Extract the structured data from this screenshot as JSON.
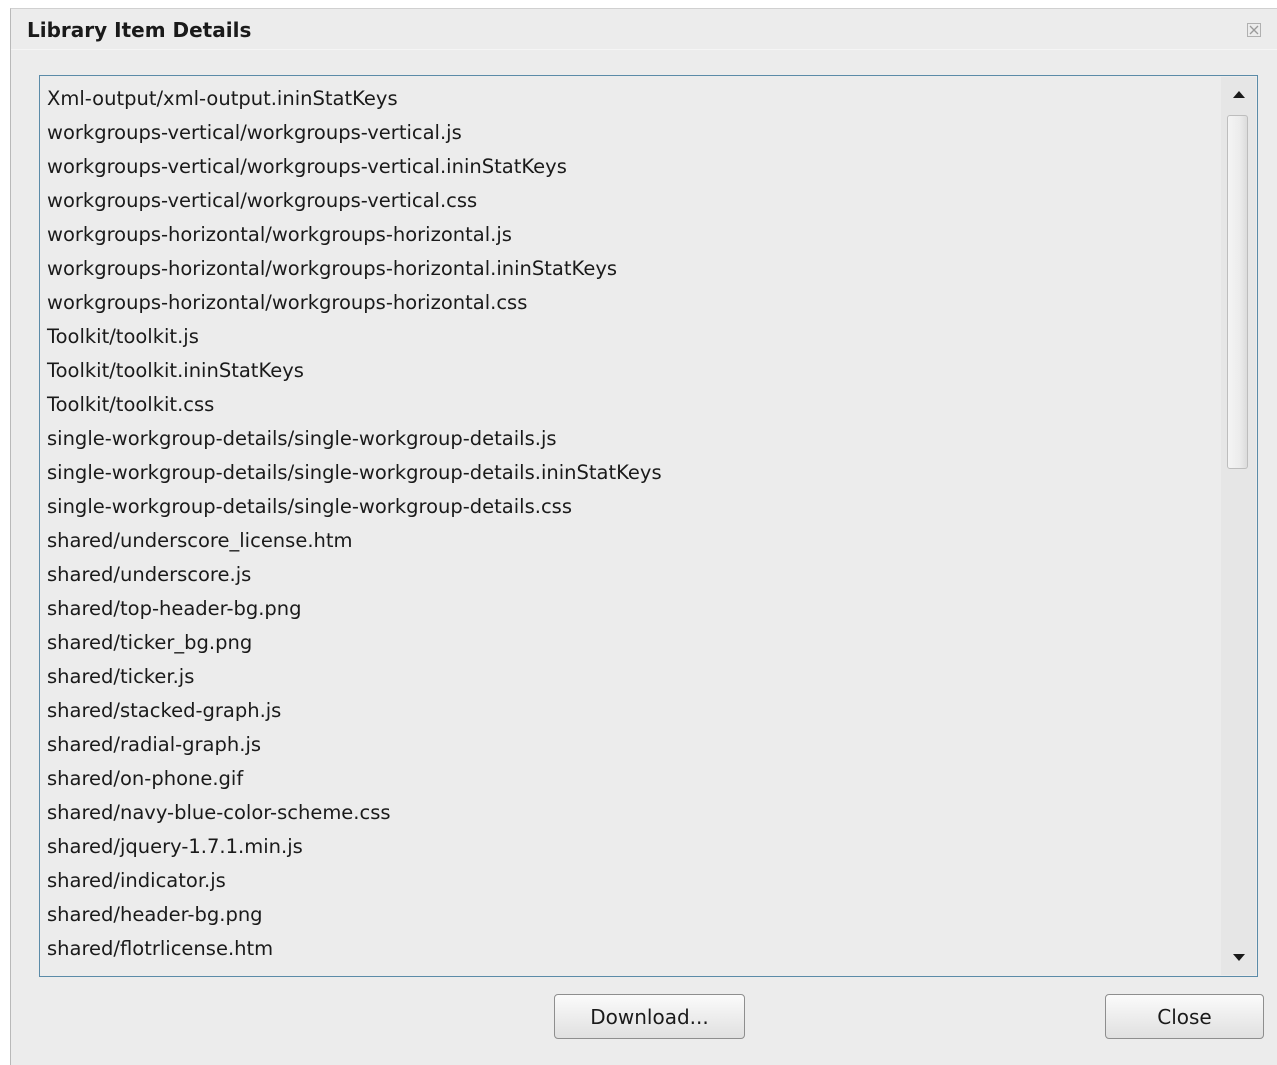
{
  "dialog": {
    "title": "Library Item Details",
    "close_icon": "close-x-icon"
  },
  "files": [
    "Xml-output/xml-output.ininStatKeys",
    "workgroups-vertical/workgroups-vertical.js",
    "workgroups-vertical/workgroups-vertical.ininStatKeys",
    "workgroups-vertical/workgroups-vertical.css",
    "workgroups-horizontal/workgroups-horizontal.js",
    "workgroups-horizontal/workgroups-horizontal.ininStatKeys",
    "workgroups-horizontal/workgroups-horizontal.css",
    "Toolkit/toolkit.js",
    "Toolkit/toolkit.ininStatKeys",
    "Toolkit/toolkit.css",
    "single-workgroup-details/single-workgroup-details.js",
    "single-workgroup-details/single-workgroup-details.ininStatKeys",
    "single-workgroup-details/single-workgroup-details.css",
    "shared/underscore_license.htm",
    "shared/underscore.js",
    "shared/top-header-bg.png",
    "shared/ticker_bg.png",
    "shared/ticker.js",
    "shared/stacked-graph.js",
    "shared/radial-graph.js",
    "shared/on-phone.gif",
    "shared/navy-blue-color-scheme.css",
    "shared/jquery-1.7.1.min.js",
    "shared/indicator.js",
    "shared/header-bg.png",
    "shared/flotrlicense.htm"
  ],
  "scrollbar": {
    "up_icon": "scroll-up-arrow-icon",
    "down_icon": "scroll-down-arrow-icon",
    "position_fraction": 0.0
  },
  "buttons": {
    "download_label": "Download...",
    "close_label": "Close"
  },
  "colors": {
    "dialog_background": "#ececec",
    "list_border": "#5b8ba8"
  }
}
